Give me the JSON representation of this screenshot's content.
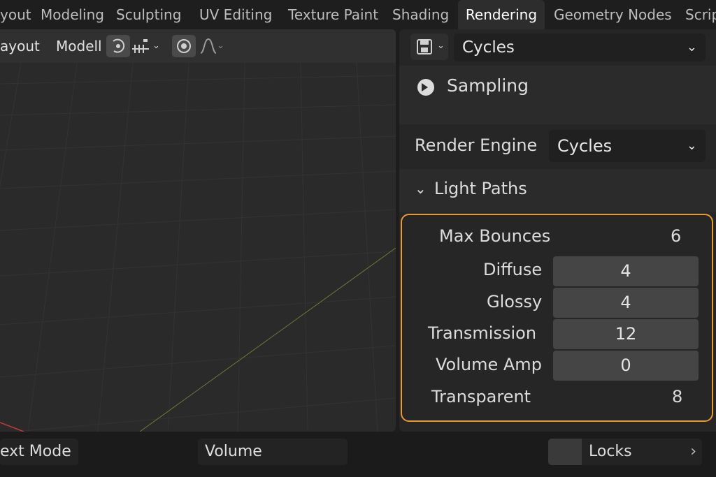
{
  "workspace_tabs": [
    {
      "label": "yout",
      "active": false
    },
    {
      "label": "Modeling",
      "active": false
    },
    {
      "label": "Sculpting",
      "active": false
    },
    {
      "label": "UV Editing",
      "active": false
    },
    {
      "label": "Texture Paint",
      "active": false
    },
    {
      "label": "Shading",
      "active": false
    },
    {
      "label": "Rendering",
      "active": true
    },
    {
      "label": "Geometry Nodes",
      "active": false
    },
    {
      "label": "Scrip",
      "active": false
    }
  ],
  "viewport_header": {
    "layout_label": "ayout",
    "modeling_label": "Modell",
    "icons": [
      "gizmo-icon",
      "transform-pivot-icon",
      "overlay-icon",
      "curve-falloff-icon"
    ]
  },
  "properties": {
    "render_icon": "render-props-icon",
    "top_engine": "Cycles",
    "section_icon": "sampling-icon",
    "section_title": "Sampling",
    "render_engine_label": "Render Engine",
    "render_engine_value": "Cycles",
    "subpanel_title": "Light Paths",
    "max_bounces_label": "Max Bounces",
    "max_bounces_value": "6",
    "rows": [
      {
        "label": "Diffuse",
        "value": "4"
      },
      {
        "label": "Glossy",
        "value": "4"
      },
      {
        "label": "Transmission",
        "value": "12"
      },
      {
        "label": "Volume Amp",
        "value": "0"
      }
    ],
    "transparent_label": "Transparent",
    "transparent_value": "8",
    "highlight_color": "#e89a2e"
  },
  "statusbar": {
    "mode_label": "ext Mode",
    "volume_label": "Volume",
    "locks_label": "Locks",
    "chevron": "›"
  },
  "colors": {
    "accent": "#e89a2e",
    "grid_line": "#353535",
    "x_axis": "#c23a3a",
    "y_axis": "#7a8a3a"
  }
}
